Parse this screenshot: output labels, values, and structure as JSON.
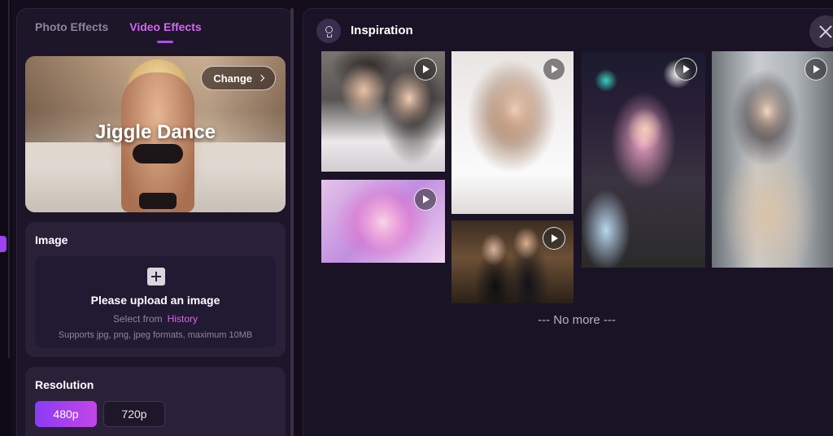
{
  "left_panel": {
    "tabs": [
      {
        "label": "Photo Effects",
        "active": false
      },
      {
        "label": "Video Effects",
        "active": true
      }
    ],
    "effect": {
      "title": "Jiggle Dance",
      "change_label": "Change"
    },
    "image_section": {
      "title": "Image",
      "upload_title": "Please upload an image",
      "select_prefix": "Select from",
      "history_label": "History",
      "formats_text": "Supports jpg, png, jpeg formats, maximum 10MB"
    },
    "resolution_section": {
      "title": "Resolution",
      "options": [
        "480p",
        "720p"
      ],
      "selected": "480p"
    }
  },
  "right_panel": {
    "title": "Inspiration",
    "footer_text": "--- No more ---"
  },
  "icons": {
    "inspiration": "lightbulb-icon",
    "close": "close-icon",
    "play": "play-icon",
    "change": "chevron-right-icon",
    "upload": "plus-icon"
  },
  "colors": {
    "accent": "#d266f5",
    "accent_gradient_start": "#8a3cf5",
    "accent_gradient_end": "#c246e8",
    "history_link": "#d866e8",
    "background": "#140d1c"
  }
}
